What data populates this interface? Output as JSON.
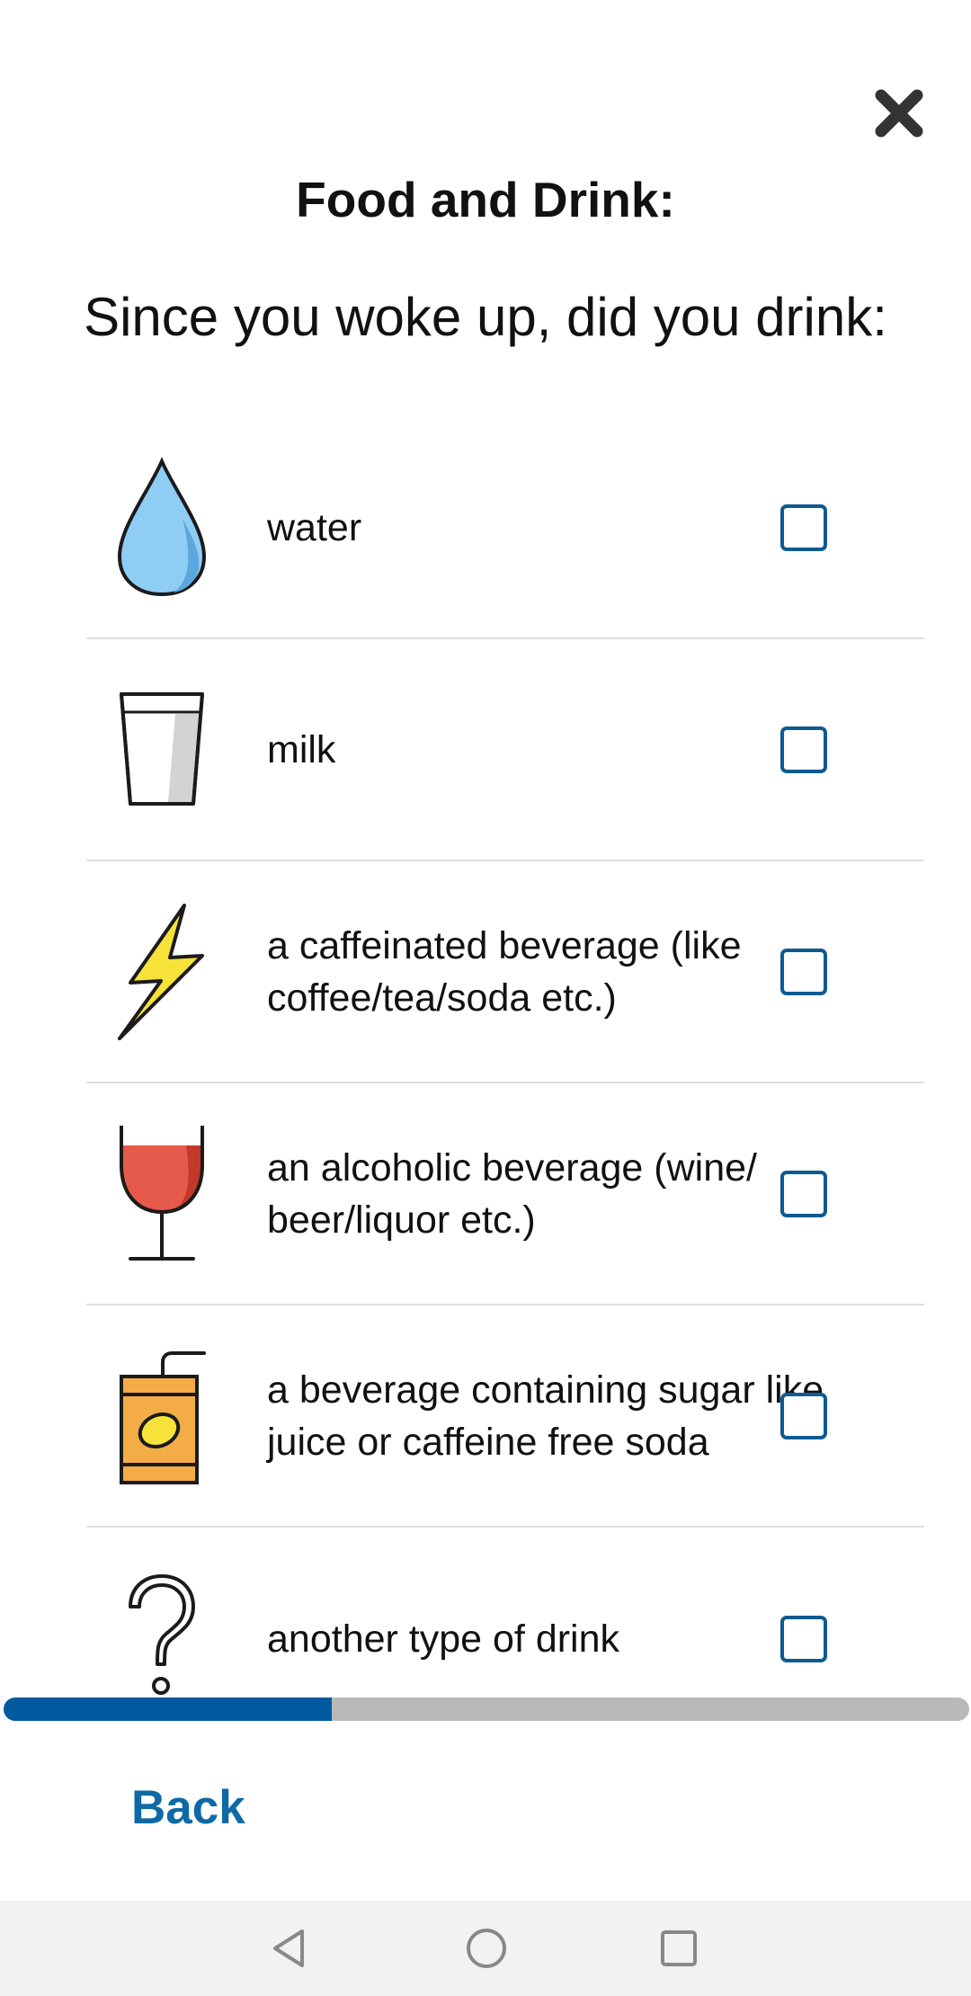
{
  "header": {
    "title": "Food and Drink:",
    "question": "Since you woke up, did you drink:"
  },
  "options": [
    {
      "label": "water",
      "icon": "water-drop-icon",
      "checked": false
    },
    {
      "label": "milk",
      "icon": "milk-glass-icon",
      "checked": false
    },
    {
      "label": "a caffeinated beverage (like coffee/tea/soda etc.)",
      "icon": "lightning-bolt-icon",
      "checked": false
    },
    {
      "label": "an alcoholic beverage (wine/ beer/liquor etc.)",
      "icon": "wine-glass-icon",
      "checked": false
    },
    {
      "label": "a beverage containing sugar like juice or caffeine free soda",
      "icon": "juice-box-icon",
      "checked": false
    },
    {
      "label": "another type of drink",
      "icon": "question-mark-icon",
      "checked": false
    }
  ],
  "progress": {
    "fraction": 0.34
  },
  "footer": {
    "back_label": "Back"
  },
  "colors": {
    "accent": "#005aa0",
    "checkbox_border": "#0e5a91",
    "link": "#0e6aa5",
    "progress_track": "#b9b9b9"
  },
  "system_nav": {
    "icons": [
      "back-triangle-icon",
      "home-circle-icon",
      "recents-square-icon"
    ]
  }
}
